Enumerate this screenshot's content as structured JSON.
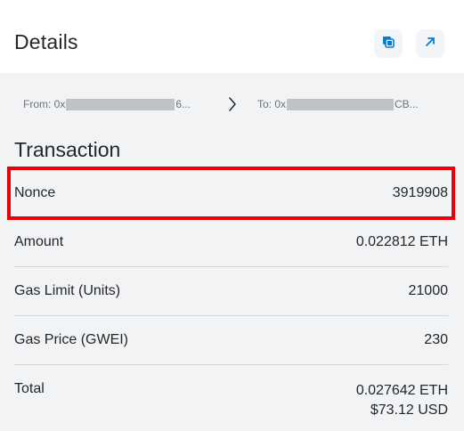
{
  "header": {
    "title": "Details",
    "copy_icon": "copy-icon",
    "view_icon": "arrow-up-right-icon"
  },
  "addresses": {
    "from_prefix": "From: 0x",
    "from_suffix": "6...",
    "to_prefix": "To: 0x",
    "to_suffix": "CB..."
  },
  "transaction": {
    "section_title": "Transaction",
    "rows": [
      {
        "label": "Nonce",
        "value": "3919908"
      },
      {
        "label": "Amount",
        "value": "0.022812 ETH"
      },
      {
        "label": "Gas Limit (Units)",
        "value": "21000"
      },
      {
        "label": "Gas Price (GWEI)",
        "value": "230"
      },
      {
        "label": "Total",
        "value": "0.027642 ETH",
        "value_fiat": "$73.12 USD"
      }
    ]
  },
  "colors": {
    "accent": "#037dd6",
    "highlight": "#e8000b",
    "background": "#f2f3f4"
  }
}
